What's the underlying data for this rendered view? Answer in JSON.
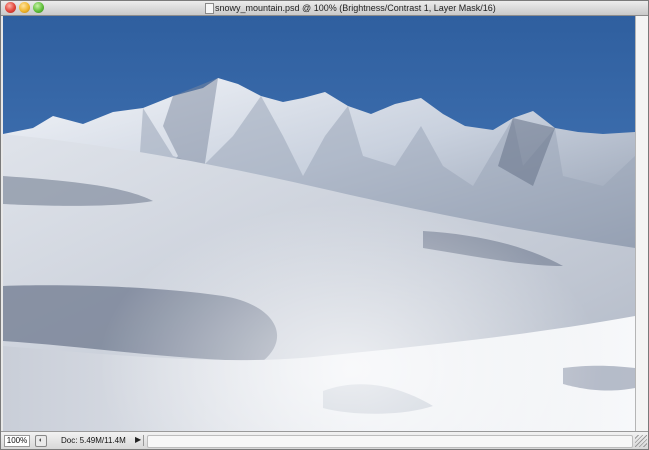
{
  "window": {
    "title": "snowy_mountain.psd @ 100% (Brightness/Contrast 1, Layer Mask/16)"
  },
  "statusbar": {
    "zoom": "100%",
    "doc_info": "Doc: 5.49M/11.4M",
    "arrow": "▶"
  },
  "icons": {
    "close": "close-button-icon",
    "minimize": "minimize-button-icon",
    "zoom": "zoom-button-icon",
    "document": "document-icon",
    "status": "status-info-icon",
    "menu_arrow": "status-menu-arrow-icon",
    "grip": "resize-grip-icon"
  },
  "colors": {
    "sky": "#3d6fb0",
    "snow": "#e4e8f0",
    "shadow": "#6f7a8f"
  }
}
